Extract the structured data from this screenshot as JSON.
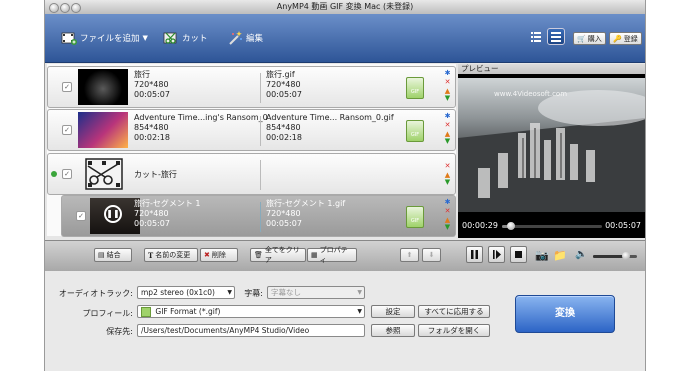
{
  "window": {
    "title": "AnyMP4 動画 GIF 変換 Mac (未登録)"
  },
  "toolbar": {
    "add_files_label": "ファイルを追加",
    "cut_label": "カット",
    "edit_label": "編集",
    "buy_label": "購入",
    "register_label": "登録"
  },
  "list": {
    "rows": [
      {
        "name": "旅行",
        "resolution": "720*480",
        "duration": "00:05:07",
        "out_name": "旅行.gif",
        "out_resolution": "720*480",
        "out_duration": "00:05:07"
      },
      {
        "name": "Adventure Time...ing's Ransom_0",
        "resolution": "854*480",
        "duration": "00:02:18",
        "out_name": "Adventure Time... Ransom_0.gif",
        "out_resolution": "854*480",
        "out_duration": "00:02:18"
      }
    ],
    "cut_group": {
      "label": "カット-旅行"
    },
    "segment": {
      "name": "旅行-セグメント 1",
      "resolution": "720*480",
      "duration": "00:05:07",
      "out_name": "旅行-セグメント 1.gif",
      "out_resolution": "720*480",
      "out_duration": "00:05:07"
    },
    "gif_badge": "GIF"
  },
  "preview": {
    "label": "プレビュー",
    "watermark": "www.4Videosoft.com",
    "current_time": "00:00:29",
    "total_time": "00:05:07",
    "progress": 0.094,
    "volume": 0.75
  },
  "bottom": {
    "merge_label": "結合",
    "rename_label": "名前の変更",
    "delete_label": "削除",
    "clear_label": "全てをクリア",
    "properties_label": "プロパティ"
  },
  "settings": {
    "audio_track_label": "オーディオトラック:",
    "audio_track_value": "mp2 stereo (0x1c0)",
    "subtitle_label": "字幕:",
    "subtitle_value": "字幕なし",
    "profile_label": "プロフィール:",
    "profile_value": "GIF Format (*.gif)",
    "settings_button": "設定",
    "apply_all_button": "すべてに応用する",
    "save_label": "保存先:",
    "save_path": "/Users/test/Documents/AnyMP4 Studio/Video",
    "browse_button": "参照",
    "open_folder_button": "フォルダを開く",
    "convert_button": "変換"
  }
}
